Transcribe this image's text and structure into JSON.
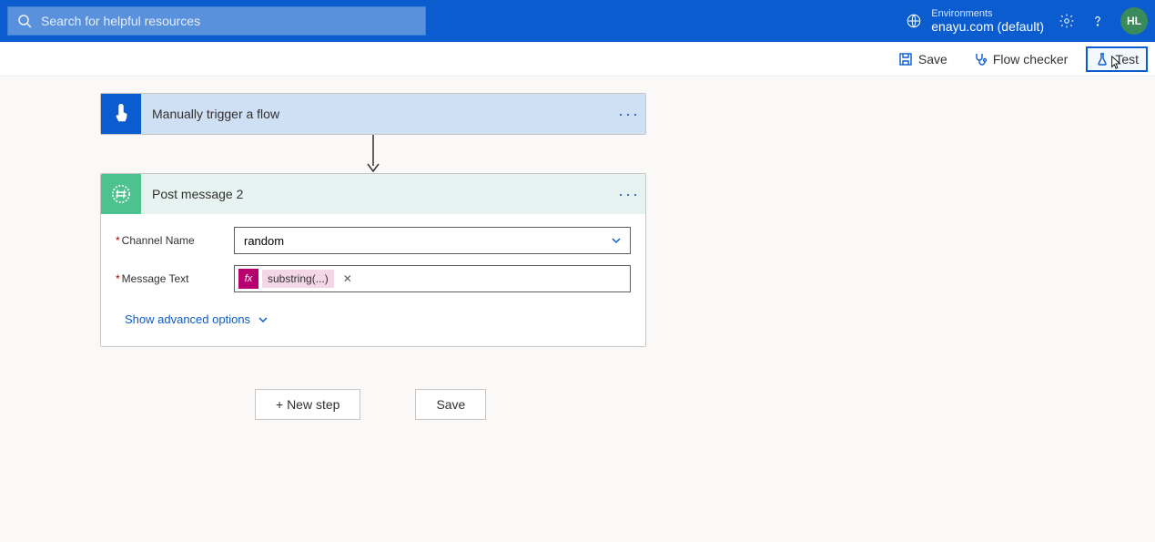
{
  "header": {
    "search_placeholder": "Search for helpful resources",
    "env_label": "Environments",
    "env_name": "enayu.com (default)",
    "avatar_initials": "HL"
  },
  "toolbar": {
    "save": "Save",
    "flow_checker": "Flow checker",
    "test": "Test"
  },
  "trigger": {
    "title": "Manually trigger a flow"
  },
  "action": {
    "title": "Post message 2",
    "fields": {
      "channel_label": "Channel Name",
      "channel_value": "random",
      "message_label": "Message Text",
      "token_label": "substring(...)"
    },
    "advanced_label": "Show advanced options"
  },
  "buttons": {
    "new_step": "+ New step",
    "save": "Save"
  }
}
